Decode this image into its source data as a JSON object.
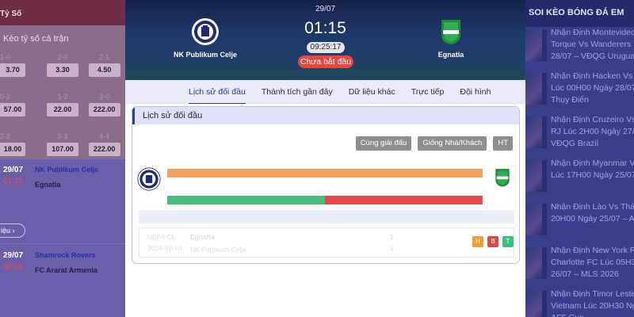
{
  "left": {
    "tab_label": "Tỷ Số",
    "section_title": "Kèo tỷ số cả trận",
    "odds": [
      [
        {
          "k": "1-0",
          "v": "3.70"
        },
        {
          "k": "2-0",
          "v": "3.30"
        },
        {
          "k": "2-1",
          "v": "4.50"
        }
      ],
      [
        {
          "k": "0-2",
          "v": "57.00"
        },
        {
          "k": "1-2",
          "v": "22.00"
        },
        {
          "k": "3-0",
          "v": "222.00"
        }
      ],
      [
        {
          "k": "2-2",
          "v": "18.00"
        },
        {
          "k": "3-3",
          "v": "107.00"
        },
        {
          "k": "4-4",
          "v": "222.00"
        }
      ]
    ],
    "match1": {
      "date": "29/07",
      "time": "01:15",
      "home": "NK Publikum Celje",
      "away": "Egnatia",
      "detail": "iệu"
    },
    "match2": {
      "date": "29/07",
      "time": "00:00",
      "home": "Shamrock Rovers",
      "away": "FC Ararat Armenia"
    }
  },
  "hero": {
    "date": "29/07",
    "kickoff": "01:15",
    "countdown": "09:25:17",
    "status": "Chưa bắt đầu",
    "home_team": "NK Publikum Celje",
    "away_team": "Egnatia"
  },
  "tabs": [
    {
      "label": "Lịch sử đối đầu",
      "active": true
    },
    {
      "label": "Thành tích gần đây"
    },
    {
      "label": "Dữ liệu khác"
    },
    {
      "label": "Trực tiếp"
    },
    {
      "label": "Đội hình"
    }
  ],
  "h2h": {
    "title": "Lịch sử đối đầu",
    "filters": [
      "Cùng giải đấu",
      "Giống Nhà/Khách",
      "HT"
    ],
    "win_share_home": 0.5,
    "row": {
      "league": "UEFA CL",
      "date": "2024-07-10",
      "home": "Egnatia",
      "away": "NK Publikum Celje",
      "s1": "1",
      "s2": "1",
      "badges": [
        "H",
        "B",
        "T"
      ]
    }
  },
  "right": {
    "header": "SOI KÈO BÓNG ĐÁ EM",
    "news": [
      [
        "Nhận Định Montevideo",
        "Torque Vs Wanderers F",
        "28/07 – VĐQG Urugua"
      ],
      [
        "Nhận Định Hacken Vs A",
        "Lúc 00H00 Ngày 28/07",
        "Thụy Điển"
      ],
      [
        "Nhận Định Cruzeiro Vs",
        "RJ Lúc 2H00 Ngày 27/0",
        "VĐQG Brazil"
      ],
      [
        "Nhận Định Myanmar Vs",
        "Lúc 17H00 Ngày 25/07"
      ],
      [
        "Nhận Định Lào Vs Thá",
        "20H00 Ngày 25/07 – A"
      ],
      [
        "Nhận Định New York R",
        "Charlotte FC Lúc 05H3",
        "26/07 – MLS 2026"
      ],
      [
        "Nhận Định Timor Leste",
        "Vietnam Lúc 20H30 Ng",
        "AFF Cup"
      ]
    ]
  },
  "colors": {
    "accent": "#2a3ba0",
    "status_red": "#e8463f",
    "orange": "#f2a15e",
    "green": "#45bb7c",
    "red": "#e34b4b"
  }
}
